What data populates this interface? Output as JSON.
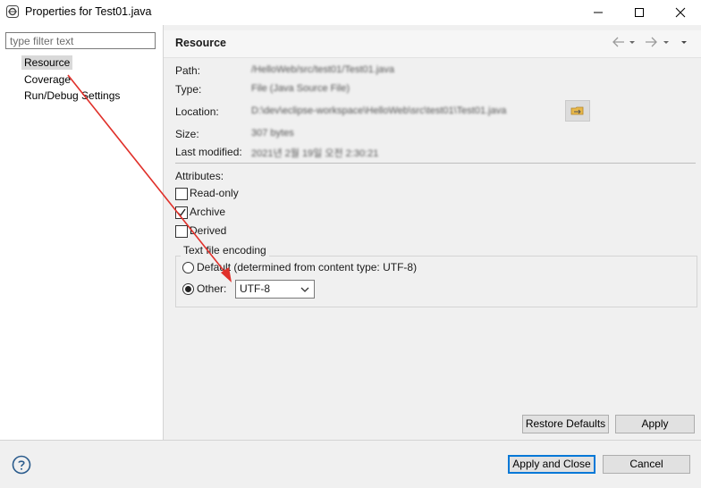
{
  "window": {
    "title": "Properties for Test01.java",
    "controls": [
      "minimize-icon",
      "maximize-icon",
      "close-icon"
    ]
  },
  "left": {
    "filter_placeholder": "type filter text",
    "tree": [
      {
        "label": "Resource",
        "selected": true
      },
      {
        "label": "Coverage",
        "selected": false
      },
      {
        "label": "Run/Debug Settings",
        "selected": false
      }
    ]
  },
  "page": {
    "title": "Resource",
    "nav_icons": [
      "back-arrow-icon",
      "back-dropdown-icon",
      "forward-arrow-icon",
      "forward-dropdown-icon",
      "view-menu-icon"
    ],
    "info": {
      "path_label": "Path:",
      "path_value": "/HelloWeb/src/test01/Test01.java",
      "type_label": "Type:",
      "type_value": "File (Java Source File)",
      "location_label": "Location:",
      "location_value": "D:\\dev\\eclipse-workspace\\HelloWeb\\src\\test01\\Test01.java",
      "size_label": "Size:",
      "size_value": "307 bytes",
      "modified_label": "Last modified:",
      "modified_value": "2021년 2월 19일 오전 2:30:21"
    },
    "attributes": {
      "title": "Attributes:",
      "items": [
        {
          "label": "Read-only",
          "checked": false
        },
        {
          "label": "Archive",
          "checked": true
        },
        {
          "label": "Derived",
          "checked": false
        }
      ]
    },
    "encoding": {
      "group_title": "Text file encoding",
      "default_label": "Default (determined from content type: UTF-8)",
      "other_label": "Other:",
      "other_value": "UTF-8",
      "selected": "other"
    },
    "buttons": {
      "restore": "Restore Defaults",
      "apply": "Apply"
    }
  },
  "footer": {
    "apply_close": "Apply and Close",
    "cancel": "Cancel"
  },
  "colors": {
    "annotation_arrow": "#e0302a",
    "primary_border": "#0078d7"
  }
}
